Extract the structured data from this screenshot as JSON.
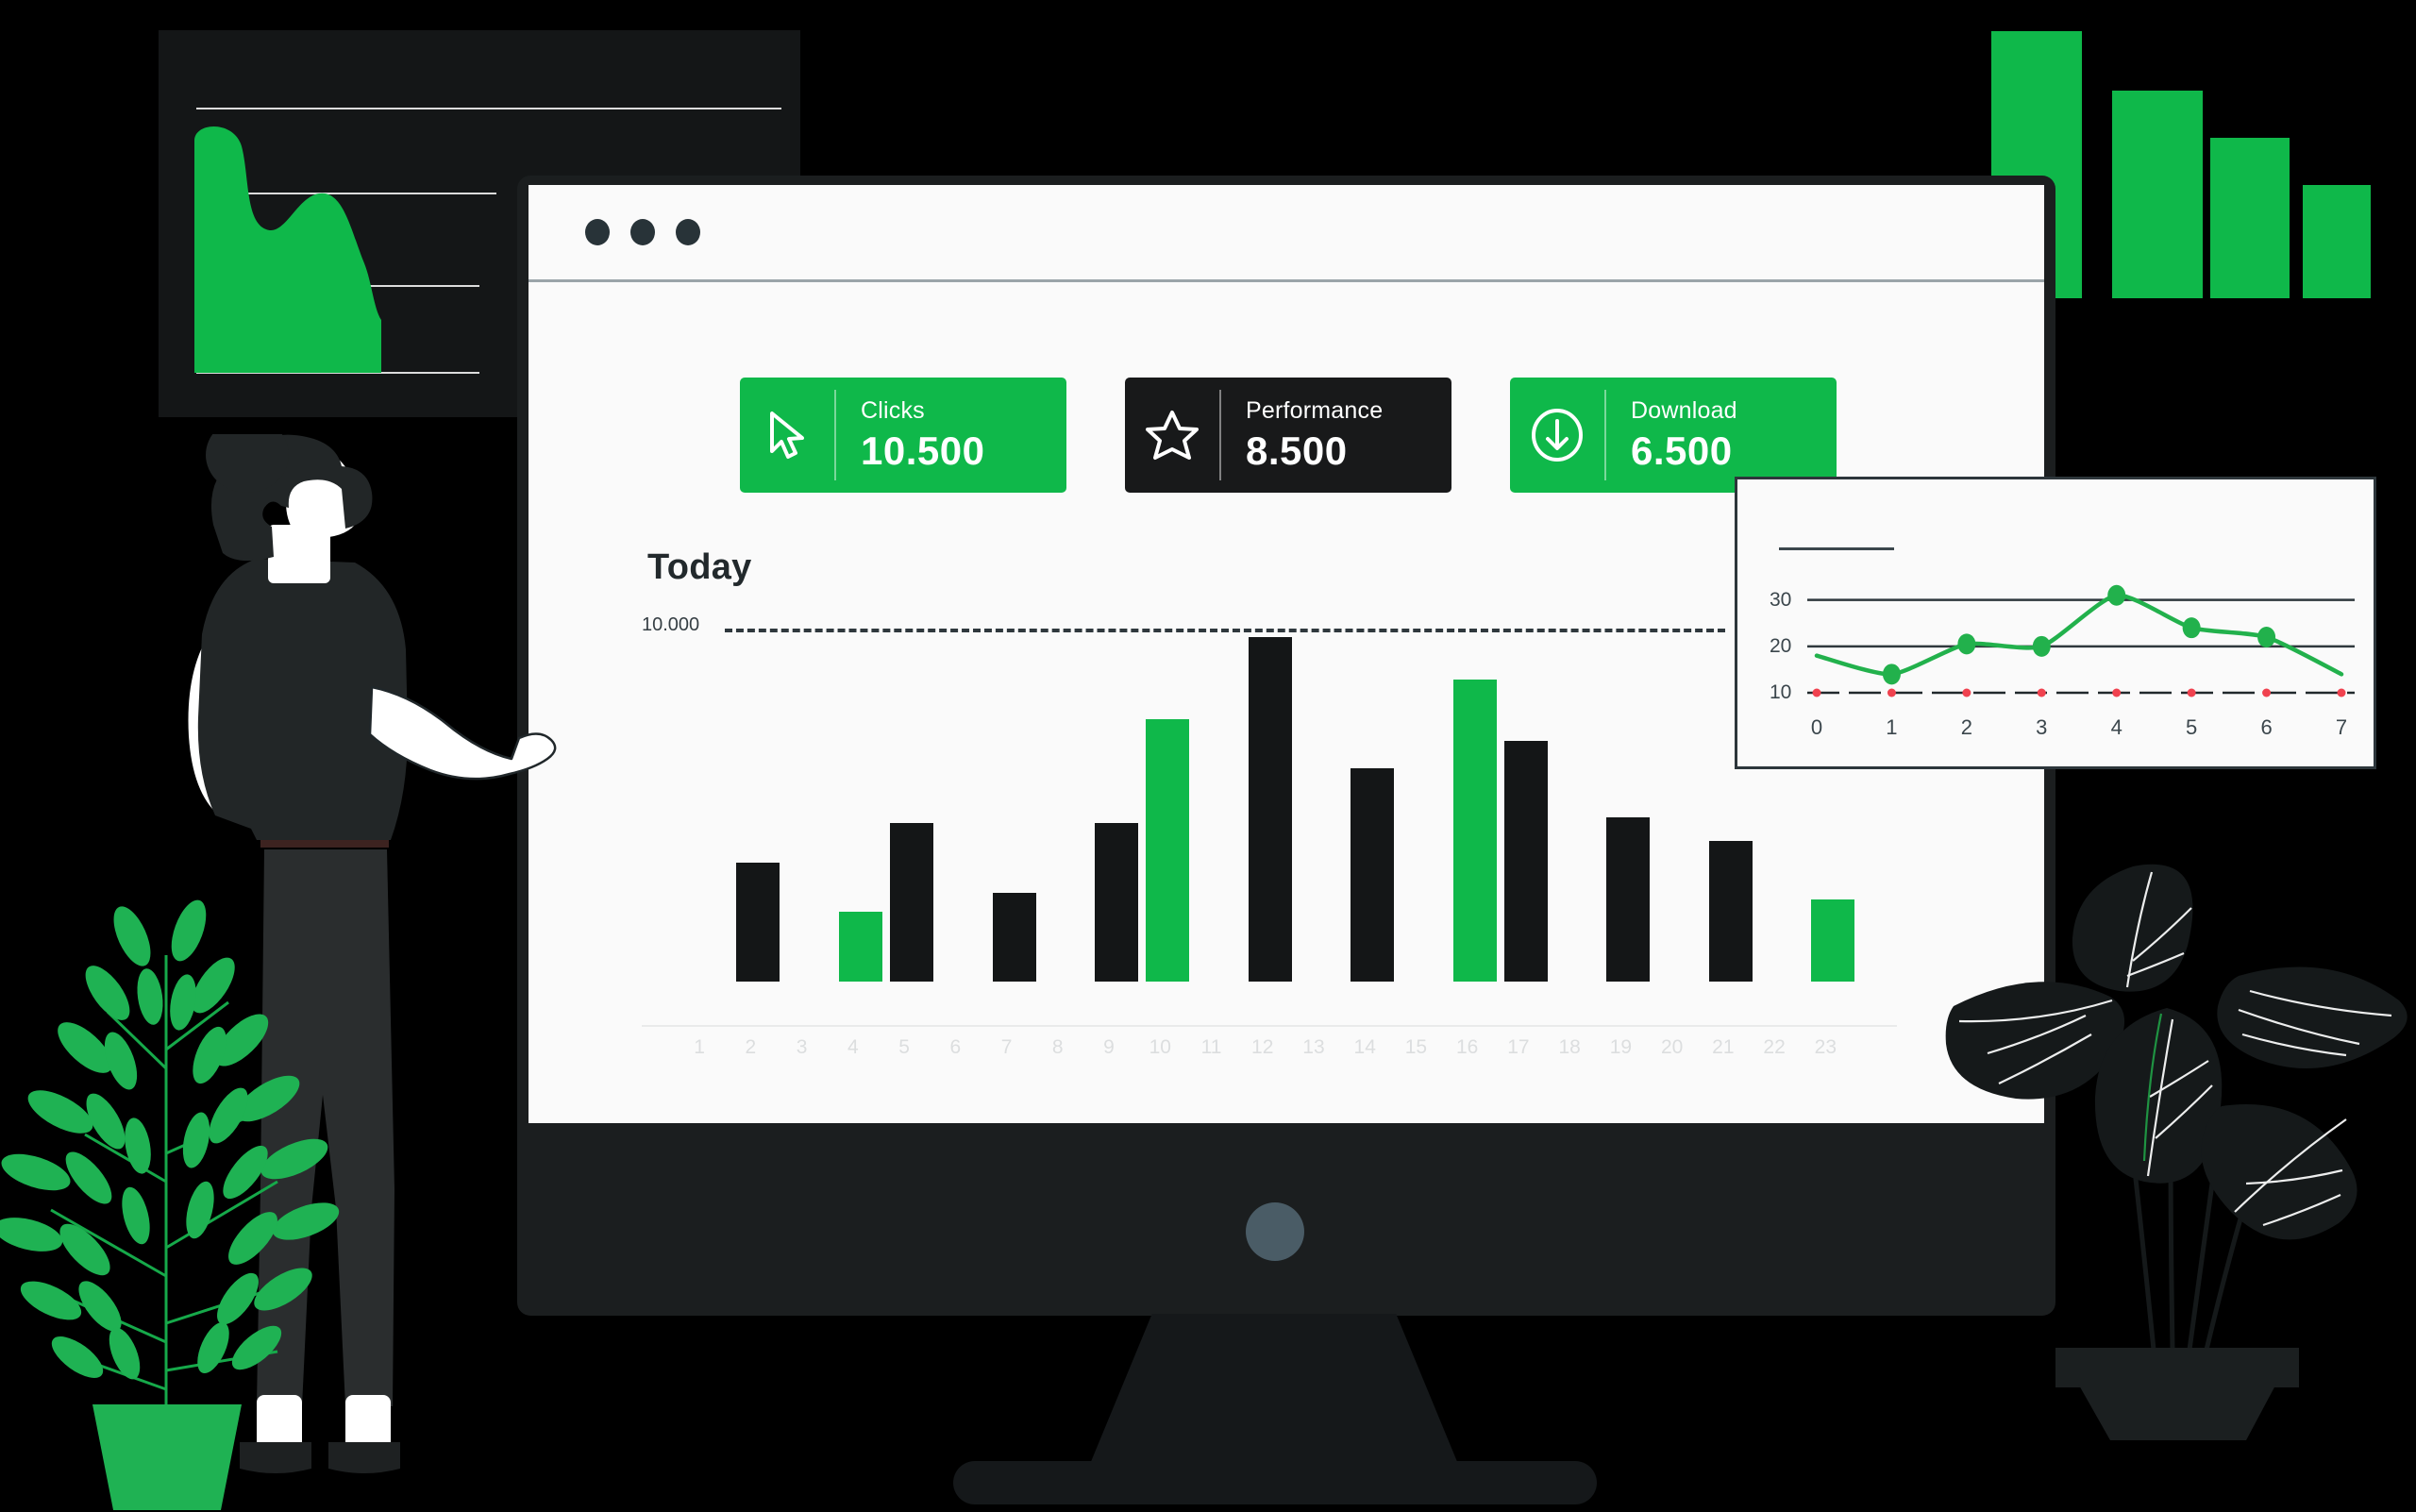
{
  "theme": {
    "background": "#000000",
    "green": "#0fb84a",
    "dark": "#141617",
    "screen_bg": "#fafafa",
    "monitor_body": "#1b1e1f",
    "text_dark": "#22292c",
    "axis_tick": "#dcdedf",
    "dot_red": "#f0424f"
  },
  "browser": {
    "dots": [
      "window-dot-1",
      "window-dot-2",
      "window-dot-3"
    ]
  },
  "kpis": [
    {
      "id": "clicks",
      "label": "Clicks",
      "value": "10.500",
      "icon": "cursor-arrow-icon",
      "style": "green"
    },
    {
      "id": "performance",
      "label": "Performance",
      "value": "8.500",
      "icon": "star-icon",
      "style": "dark"
    },
    {
      "id": "download",
      "label": "Download",
      "value": "6.500",
      "icon": "download-circle-icon",
      "style": "green"
    }
  ],
  "main_chart": {
    "title": "Today",
    "threshold_label": "10.000"
  },
  "inset_chart": {
    "title_placeholder": ""
  },
  "chart_data": [
    {
      "id": "today-bar-chart",
      "type": "bar",
      "title": "Today",
      "xlabel": "",
      "ylabel": "",
      "grid": false,
      "legend": null,
      "threshold": {
        "value": 10000,
        "label": "10.000",
        "style": "dashed"
      },
      "ylim": [
        0,
        13000
      ],
      "categories": [
        "1",
        "2",
        "3",
        "4",
        "5",
        "6",
        "7",
        "8",
        "9",
        "10",
        "11",
        "12",
        "13",
        "14",
        "15",
        "16",
        "17",
        "18",
        "19",
        "20",
        "21",
        "22",
        "23"
      ],
      "tick_labels": [
        "1",
        "2",
        "3",
        "4",
        "5",
        "6",
        "7",
        "8",
        "9",
        "10",
        "11",
        "12",
        "13",
        "14",
        "15",
        "16",
        "17",
        "18",
        "19",
        "20",
        "21",
        "22",
        "23"
      ],
      "bars": [
        {
          "x": 2,
          "value": 3900,
          "color": "dark"
        },
        {
          "x": 4,
          "value": 2300,
          "color": "green"
        },
        {
          "x": 5,
          "value": 5200,
          "color": "dark"
        },
        {
          "x": 7,
          "value": 2900,
          "color": "dark"
        },
        {
          "x": 9,
          "value": 5200,
          "color": "dark"
        },
        {
          "x": 10,
          "value": 8600,
          "color": "green"
        },
        {
          "x": 12,
          "value": 11300,
          "color": "dark"
        },
        {
          "x": 14,
          "value": 7000,
          "color": "dark"
        },
        {
          "x": 16,
          "value": 9900,
          "color": "green"
        },
        {
          "x": 17,
          "value": 7900,
          "color": "dark"
        },
        {
          "x": 19,
          "value": 5400,
          "color": "dark"
        },
        {
          "x": 21,
          "value": 4600,
          "color": "dark"
        },
        {
          "x": 23,
          "value": 2700,
          "color": "green"
        }
      ]
    },
    {
      "id": "inset-line-chart",
      "type": "line",
      "title": "",
      "xlabel": "",
      "ylabel": "",
      "grid": true,
      "gridlines_y": [
        20,
        30
      ],
      "ylim": [
        10,
        34
      ],
      "xlim": [
        0,
        7
      ],
      "y_tick_labels": [
        "30",
        "20",
        "10"
      ],
      "x_tick_labels": [
        "0",
        "1",
        "2",
        "3",
        "4",
        "5",
        "6",
        "7"
      ],
      "series": [
        {
          "name": "trend",
          "color": "#22b14c",
          "x": [
            0,
            1,
            2,
            3,
            4,
            5,
            6,
            7
          ],
          "values": [
            18,
            14,
            20.5,
            20,
            31,
            24,
            22,
            14
          ],
          "marker_points": [
            {
              "x": 1,
              "y": 14
            },
            {
              "x": 2,
              "y": 20.5
            },
            {
              "x": 3,
              "y": 20
            },
            {
              "x": 4,
              "y": 31
            },
            {
              "x": 5,
              "y": 24
            },
            {
              "x": 6,
              "y": 22
            }
          ]
        },
        {
          "name": "baseline-markers",
          "color": "#f0424f",
          "x": [
            0,
            1,
            2,
            3,
            4,
            5,
            6,
            7
          ],
          "values": [
            10,
            10,
            10,
            10,
            10,
            10,
            10,
            10
          ]
        }
      ]
    },
    {
      "id": "deco-area-chart",
      "type": "area",
      "title": "",
      "grid": true,
      "color": "#0fb84a",
      "x": [
        0,
        1,
        2,
        3,
        4,
        5
      ],
      "values": [
        0,
        96,
        52,
        68,
        58,
        8
      ]
    },
    {
      "id": "deco-bar-chart",
      "type": "bar",
      "title": "",
      "color": "#0fb84a",
      "categories": [
        "1",
        "2",
        "3",
        "4"
      ],
      "values": [
        100,
        78,
        60,
        42
      ]
    }
  ],
  "decor": {
    "plant_left": "potted-fern-plant",
    "plant_right": "potted-leafy-plant",
    "person": "person-presenting"
  }
}
